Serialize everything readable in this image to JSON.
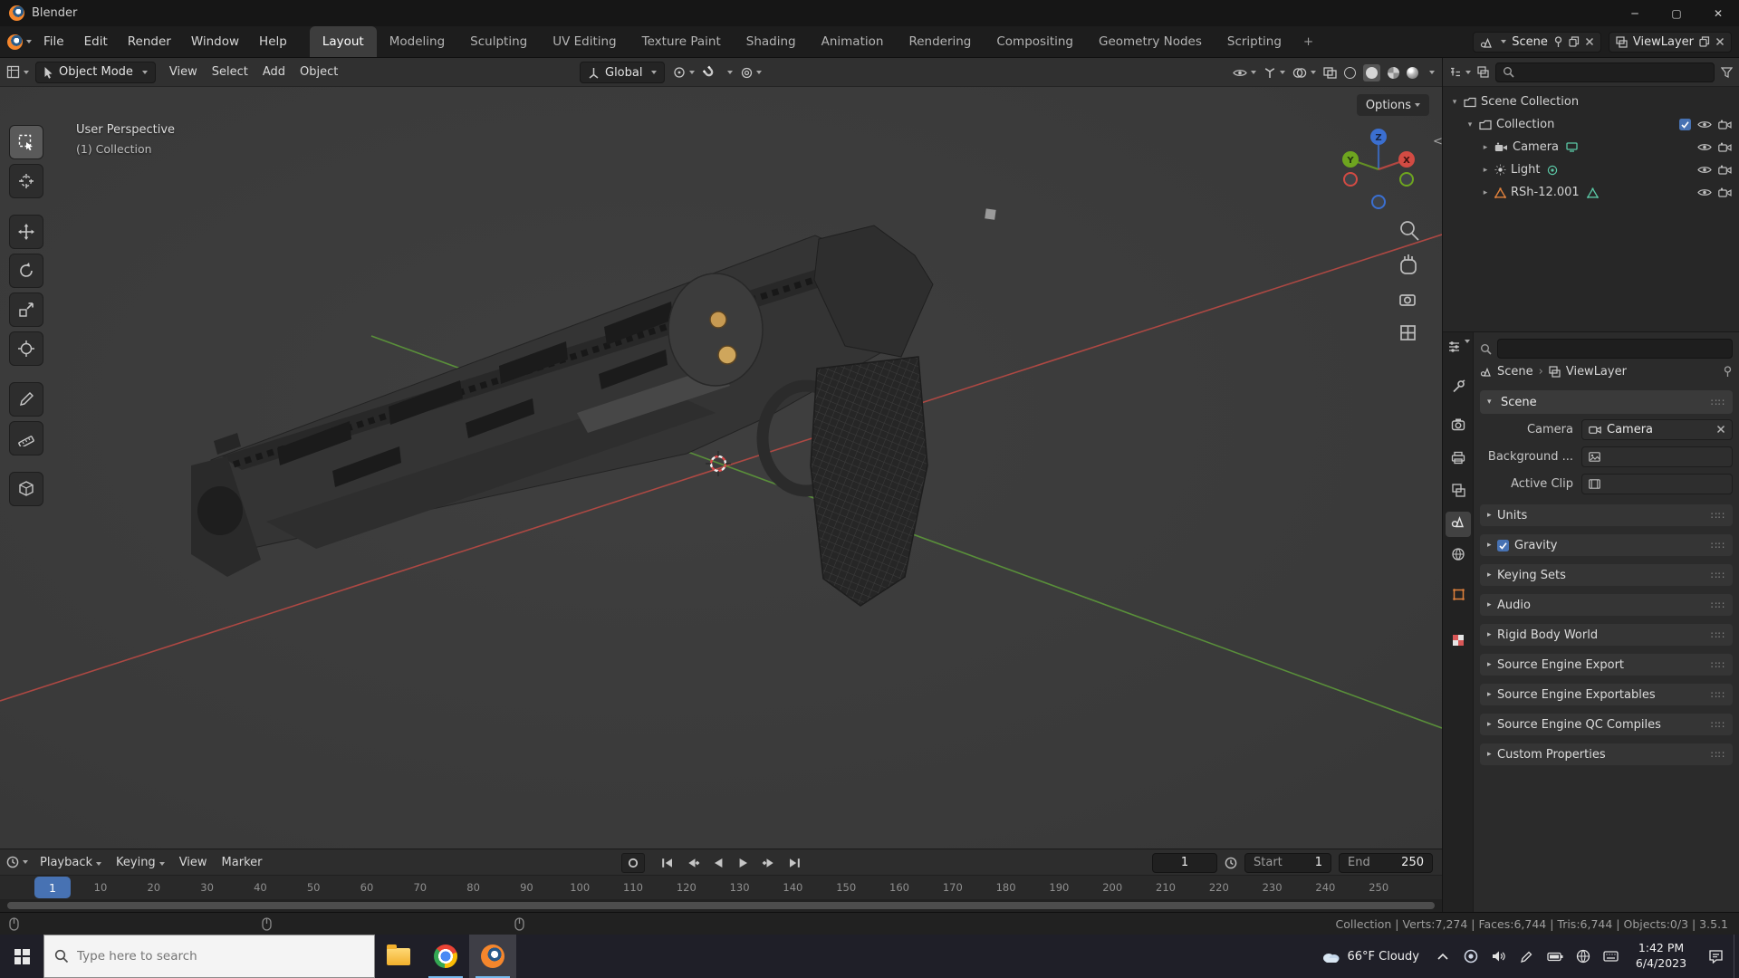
{
  "colors": {
    "accent": "#4772b3",
    "blender_orange": "#f5862c"
  },
  "window": {
    "title": "Blender"
  },
  "topbar": {
    "menus": [
      "File",
      "Edit",
      "Render",
      "Window",
      "Help"
    ],
    "workspaces": [
      "Layout",
      "Modeling",
      "Sculpting",
      "UV Editing",
      "Texture Paint",
      "Shading",
      "Animation",
      "Rendering",
      "Compositing",
      "Geometry Nodes",
      "Scripting"
    ],
    "active_workspace": "Layout",
    "add_tab": "+",
    "scene": "Scene",
    "viewlayer": "ViewLayer"
  },
  "viewport": {
    "mode": "Object Mode",
    "menus": [
      "View",
      "Select",
      "Add",
      "Object"
    ],
    "orientation": "Global",
    "options": "Options",
    "overlay_line1": "User Perspective",
    "overlay_line2": "(1) Collection",
    "axis_labels": {
      "x": "X",
      "y": "Y",
      "z": "Z"
    }
  },
  "outliner": {
    "items": [
      {
        "label": "Scene Collection",
        "type": "collection",
        "depth": 0,
        "arrow": "down"
      },
      {
        "label": "Collection",
        "type": "collection",
        "depth": 1,
        "arrow": "down",
        "check": true,
        "eye": true,
        "cam": true
      },
      {
        "label": "Camera",
        "type": "camera",
        "depth": 2,
        "arrow": "right",
        "badge": "screen",
        "eye": true,
        "cam": true
      },
      {
        "label": "Light",
        "type": "light",
        "depth": 2,
        "arrow": "right",
        "badge": "dot",
        "eye": true,
        "cam": true
      },
      {
        "label": "RSh-12.001",
        "type": "mesh",
        "depth": 2,
        "arrow": "right",
        "badge": "tri",
        "eye": true,
        "cam": true
      }
    ]
  },
  "properties": {
    "breadcrumb_scene": "Scene",
    "breadcrumb_viewlayer": "ViewLayer",
    "panel_title": "Scene",
    "fields": [
      {
        "label": "Camera",
        "value": "Camera",
        "icon": "camsmall",
        "clearable": true
      },
      {
        "label": "Background ...",
        "value": "",
        "icon": "image"
      },
      {
        "label": "Active Clip",
        "value": "",
        "icon": "clip"
      }
    ],
    "sections": [
      {
        "label": "Units"
      },
      {
        "label": "Gravity",
        "checkbox": true
      },
      {
        "label": "Keying Sets"
      },
      {
        "label": "Audio"
      },
      {
        "label": "Rigid Body World"
      },
      {
        "label": "Source Engine Export"
      },
      {
        "label": "Source Engine Exportables"
      },
      {
        "label": "Source Engine QC Compiles"
      },
      {
        "label": "Custom Properties"
      }
    ]
  },
  "timeline": {
    "menus": [
      {
        "label": "Playback",
        "caret": true
      },
      {
        "label": "Keying",
        "caret": true
      },
      {
        "label": "View"
      },
      {
        "label": "Marker"
      }
    ],
    "current_frame": "1",
    "start_label": "Start",
    "start_value": "1",
    "end_label": "End",
    "end_value": "250",
    "ruler": [
      "10",
      "20",
      "30",
      "40",
      "50",
      "60",
      "70",
      "80",
      "90",
      "100",
      "110",
      "120",
      "130",
      "140",
      "150",
      "160",
      "170",
      "180",
      "190",
      "200",
      "210",
      "220",
      "230",
      "240",
      "250"
    ]
  },
  "statusbar": {
    "stats": "Collection | Verts:7,274 | Faces:6,744 | Tris:6,744 | Objects:0/3 | 3.5.1"
  },
  "taskbar": {
    "search_placeholder": "Type here to search",
    "weather": "66°F Cloudy",
    "time": "1:42 PM",
    "date": "6/4/2023"
  }
}
